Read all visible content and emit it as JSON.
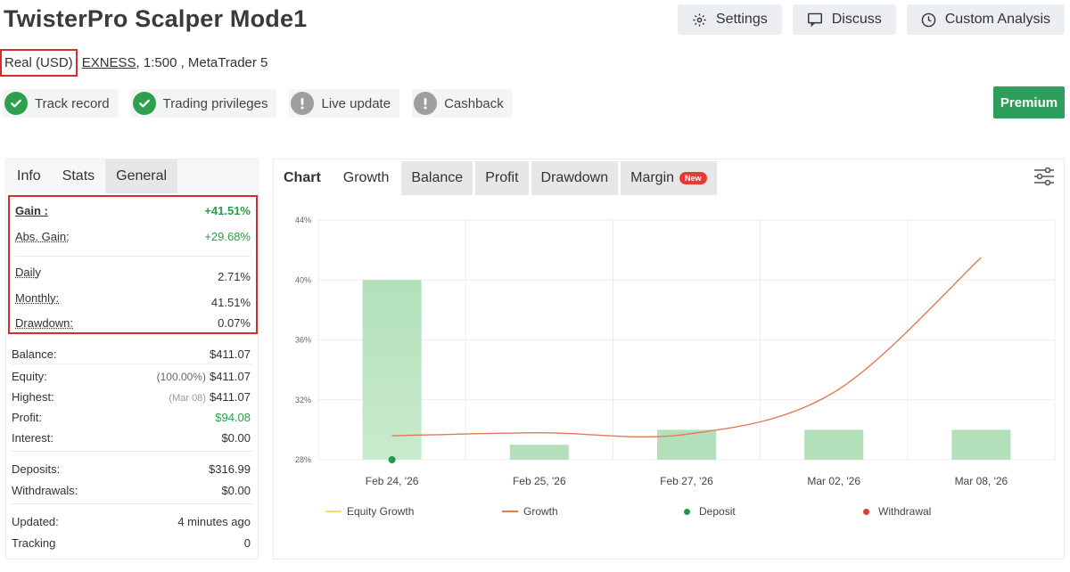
{
  "header": {
    "title": "TwisterPro Scalper Mode1",
    "buttons": {
      "settings": "Settings",
      "discuss": "Discuss",
      "custom_analysis": "Custom Analysis"
    }
  },
  "account": {
    "type": "Real (USD)",
    "broker": "EXNESS",
    "details": ", 1:500 , MetaTrader 5"
  },
  "badges": {
    "track_record": "Track record",
    "trading_privileges": "Trading privileges",
    "live_update": "Live update",
    "cashback": "Cashback"
  },
  "premium_label": "Premium",
  "left_tabs": {
    "info": "Info",
    "stats": "Stats",
    "general": "General"
  },
  "gain_stats": {
    "gain": {
      "label": "Gain :",
      "value": "+41.51%"
    },
    "abs_gain": {
      "label": "Abs. Gain:",
      "value": "+29.68%"
    },
    "daily": {
      "label": "Daily",
      "value": "2.71%"
    },
    "monthly": {
      "label": "Monthly:",
      "value": "41.51%"
    },
    "drawdown": {
      "label": "Drawdown:",
      "value": "0.07%"
    }
  },
  "account_stats": {
    "balance": {
      "label": "Balance:",
      "value": "$411.07"
    },
    "equity": {
      "label": "Equity:",
      "note": "(100.00%)",
      "value": "$411.07"
    },
    "highest": {
      "label": "Highest:",
      "note": "(Mar 08)",
      "value": "$411.07"
    },
    "profit": {
      "label": "Profit:",
      "value": "$94.08"
    },
    "interest": {
      "label": "Interest:",
      "value": "$0.00"
    },
    "deposits": {
      "label": "Deposits:",
      "value": "$316.99"
    },
    "withdrawals": {
      "label": "Withdrawals:",
      "value": "$0.00"
    },
    "updated": {
      "label": "Updated:",
      "value": "4 minutes ago"
    },
    "tracking": {
      "label": "Tracking",
      "value": "0"
    }
  },
  "chart_tabs": {
    "label": "Chart",
    "growth": "Growth",
    "balance": "Balance",
    "profit": "Profit",
    "drawdown": "Drawdown",
    "margin": "Margin",
    "new_tag": "New"
  },
  "chart_data": {
    "type": "bar",
    "categories": [
      "Feb 24, '26",
      "Feb 25, '26",
      "Feb 27, '26",
      "Mar 02, '26",
      "Mar 08, '26"
    ],
    "y_tick_labels": [
      "28%",
      "32%",
      "36%",
      "40%",
      "44%"
    ],
    "ylim": [
      28,
      44
    ],
    "grid": true,
    "series": [
      {
        "name": "Equity Growth",
        "kind": "bar",
        "values": [
          40.0,
          29.0,
          30.0,
          30.0,
          30.0
        ],
        "color": "#b3e0ba"
      },
      {
        "name": "Growth",
        "kind": "line",
        "values": [
          29.6,
          29.8,
          29.7,
          32.5,
          41.5
        ],
        "color": "#e07b55"
      },
      {
        "name": "Deposit",
        "kind": "marker",
        "values": [
          28.0,
          null,
          null,
          null,
          null
        ],
        "color": "#1e9b50"
      },
      {
        "name": "Withdrawal",
        "kind": "marker",
        "values": [
          null,
          null,
          null,
          null,
          null
        ],
        "color": "#e53935"
      }
    ],
    "legend": {
      "equity_growth": "Equity Growth",
      "growth": "Growth",
      "deposit": "Deposit",
      "withdrawal": "Withdrawal"
    },
    "colors": {
      "equity": "#e8e26a",
      "growth": "#e07b55",
      "deposit": "#1e9b50",
      "withdrawal": "#e53935"
    },
    "legend_position": "bottom"
  },
  "colors": {
    "accent_green": "#2e9e5b",
    "highlight_red": "#d32f2f"
  }
}
